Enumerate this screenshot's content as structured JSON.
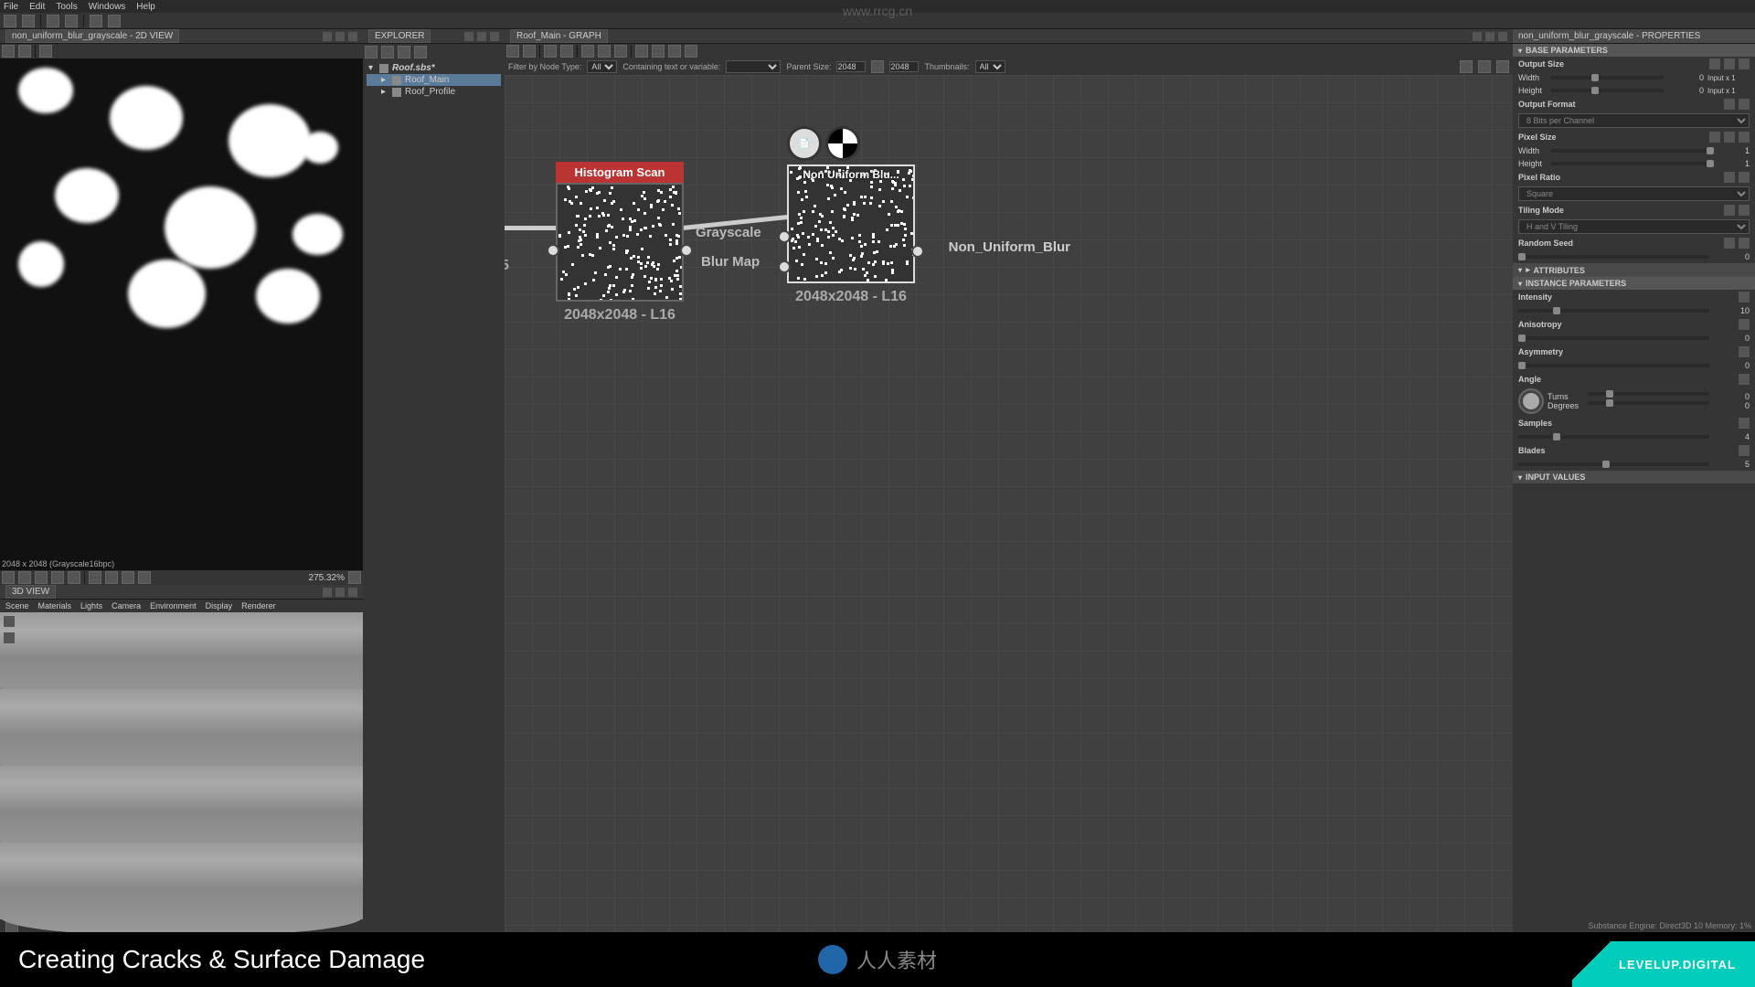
{
  "watermark_url": "www.rrcg.cn",
  "menubar": [
    "File",
    "Edit",
    "Tools",
    "Windows",
    "Help"
  ],
  "left": {
    "view2d": {
      "title": "non_uniform_blur_grayscale - 2D VIEW",
      "status": "2048 x 2048 (Grayscale16bpc)",
      "zoom": "275.32%"
    },
    "view3d": {
      "title": "3D VIEW",
      "menu": [
        "Scene",
        "Materials",
        "Lights",
        "Camera",
        "Environment",
        "Display",
        "Renderer"
      ]
    }
  },
  "explorer": {
    "title": "EXPLORER",
    "items": [
      {
        "label": "Roof.sbs*",
        "indent": 0
      },
      {
        "label": "Roof_Main",
        "indent": 1,
        "selected": true
      },
      {
        "label": "Roof_Profile",
        "indent": 1
      }
    ]
  },
  "graph": {
    "title": "Roof_Main - GRAPH",
    "filters": {
      "node_type_label": "Filter by Node Type:",
      "node_type_value": "All",
      "text_label": "Containing text or variable:",
      "parent_size_label": "Parent Size:",
      "parent_size_value": "2048",
      "parent_size_value2": "2048",
      "thumbnails_label": "Thumbnails:",
      "thumbnails_value": "All"
    },
    "nodes": {
      "left": {
        "title": "Histogram Scan",
        "resolution": "2048x2048 - L16"
      },
      "right": {
        "title": "Non Uniform Blu...",
        "resolution": "2048x2048 - L16",
        "port_grayscale": "Grayscale",
        "port_blurmap": "Blur Map",
        "output_label": "Non_Uniform_Blur"
      },
      "partial_res": "5"
    }
  },
  "properties": {
    "title": "non_uniform_blur_grayscale - PROPERTIES",
    "sections": {
      "base": "BASE PARAMETERS",
      "attributes": "ATTRIBUTES",
      "instance": "INSTANCE PARAMETERS",
      "input": "INPUT VALUES"
    },
    "base": {
      "output_size": "Output Size",
      "width_label": "Width",
      "width_value": "0",
      "width_suffix": "Input x 1",
      "height_label": "Height",
      "height_value": "0",
      "height_suffix": "Input x 1",
      "output_format": "Output Format",
      "output_format_value": "8 Bits per Channel",
      "pixel_size": "Pixel Size",
      "ps_width": "Width",
      "ps_width_val": "1",
      "ps_height": "Height",
      "ps_height_val": "1",
      "pixel_ratio": "Pixel Ratio",
      "pixel_ratio_val": "Square",
      "tiling_mode": "Tiling Mode",
      "tiling_mode_val": "H and V Tiling",
      "random_seed": "Random Seed",
      "random_seed_val": "0"
    },
    "instance": {
      "intensity": "Intensity",
      "intensity_val": "10",
      "anisotropy": "Anisotropy",
      "anisotropy_val": "0",
      "asymmetry": "Asymmetry",
      "asymmetry_val": "0",
      "angle": "Angle",
      "turns": "Turns",
      "turns_val": "0",
      "degrees": "Degrees",
      "degrees_val": "0",
      "samples": "Samples",
      "samples_val": "4",
      "blades": "Blades",
      "blades_val": "5"
    }
  },
  "statusbar": "Substance Engine: Direct3D 10   Memory: 1%",
  "footer": {
    "title": "Creating Cracks & Surface Damage",
    "center": "人人素材",
    "right": "LEVELUP.DIGITAL"
  }
}
